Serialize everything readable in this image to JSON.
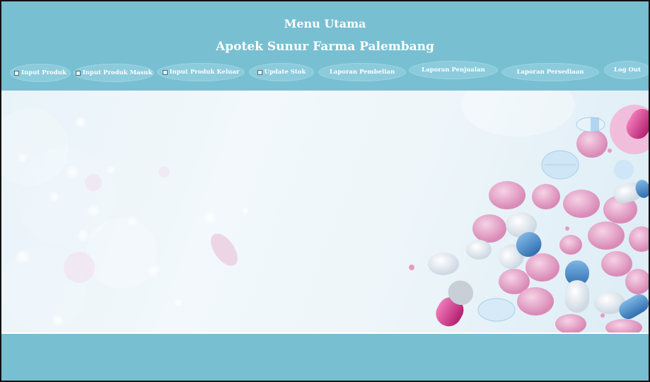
{
  "header": {
    "title": "Menu Utama",
    "subtitle": "Apotek Sunur Farma Palembang"
  },
  "nav": {
    "items": [
      {
        "label": "Input Produk",
        "icon": "document-icon"
      },
      {
        "label": "Input Produk Masuk",
        "icon": "document-icon"
      },
      {
        "label": "Input Produk Keluar",
        "icon": "document-icon"
      },
      {
        "label": "Update Stok",
        "icon": "document-icon"
      },
      {
        "label": "Laporan Pembelian"
      },
      {
        "label": "Laporan Penjualan"
      },
      {
        "label": "Laporan Persediaan"
      },
      {
        "label": "Log Out"
      }
    ]
  },
  "colors": {
    "header_bg": "#78bfd2",
    "nav_button_bg": "#8ccbdc",
    "text": "#ffffff"
  },
  "banner": {
    "image": "pills-and-capsules-image"
  }
}
